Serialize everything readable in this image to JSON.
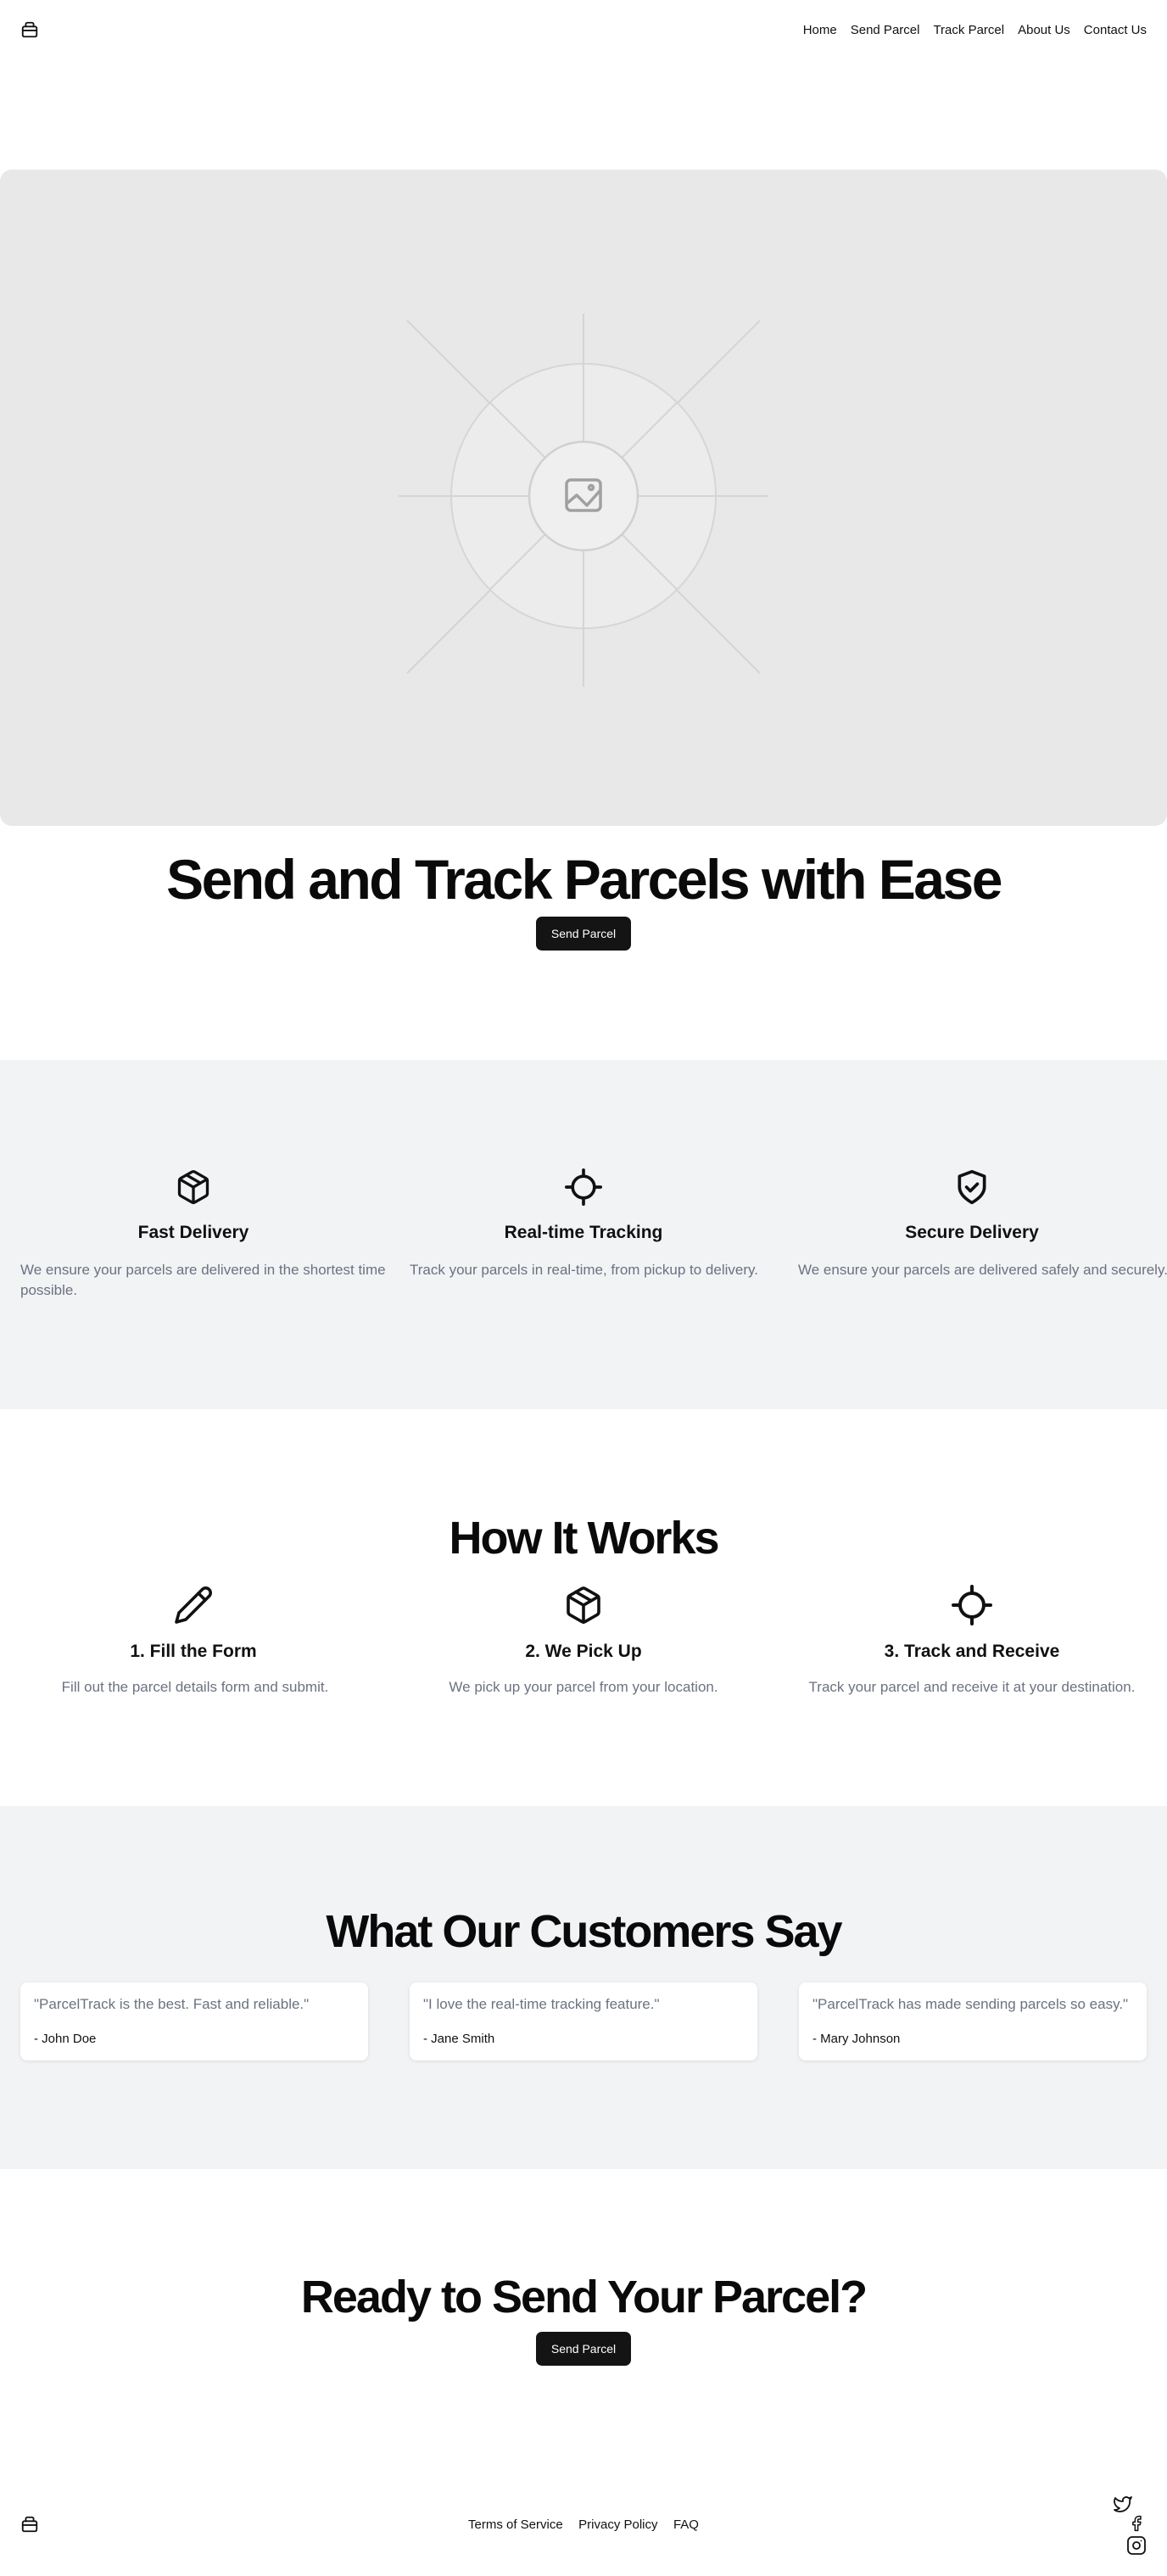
{
  "nav": {
    "items": [
      {
        "label": "Home"
      },
      {
        "label": "Send Parcel"
      },
      {
        "label": "Track Parcel"
      },
      {
        "label": "About Us"
      },
      {
        "label": "Contact Us"
      }
    ]
  },
  "hero": {
    "title": "Send and Track Parcels with Ease",
    "cta_label": "Send Parcel",
    "image_icon": "image-placeholder-icon"
  },
  "features": [
    {
      "icon": "package-icon",
      "title": "Fast Delivery",
      "description": "We ensure your parcels are delivered in the shortest time possible."
    },
    {
      "icon": "crosshair-icon",
      "title": "Real-time Tracking",
      "description": "Track your parcels in real-time, from pickup to delivery."
    },
    {
      "icon": "shield-check-icon",
      "title": "Secure Delivery",
      "description": "We ensure your parcels are delivered safely and securely."
    }
  ],
  "how_it_works": {
    "title": "How It Works",
    "steps": [
      {
        "icon": "pencil-icon",
        "title": "1. Fill the Form",
        "description": "Fill out the parcel details form and submit."
      },
      {
        "icon": "package-icon",
        "title": "2. We Pick Up",
        "description": "We pick up your parcel from your location."
      },
      {
        "icon": "crosshair-icon",
        "title": "3. Track and Receive",
        "description": "Track your parcel and receive it at your destination."
      }
    ]
  },
  "testimonials": {
    "title": "What Our Customers Say",
    "items": [
      {
        "quote": "\"ParcelTrack is the best. Fast and reliable.\"",
        "author": "- John Doe"
      },
      {
        "quote": "\"I love the real-time tracking feature.\"",
        "author": "- Jane Smith"
      },
      {
        "quote": "\"ParcelTrack has made sending parcels so easy.\"",
        "author": "- Mary Johnson"
      }
    ]
  },
  "cta": {
    "title": "Ready to Send Your Parcel?",
    "button_label": "Send Parcel"
  },
  "footer": {
    "links": [
      {
        "label": "Terms of Service"
      },
      {
        "label": "Privacy Policy"
      },
      {
        "label": "FAQ"
      }
    ],
    "social_icons": [
      "twitter-icon",
      "facebook-icon",
      "instagram-icon"
    ]
  }
}
